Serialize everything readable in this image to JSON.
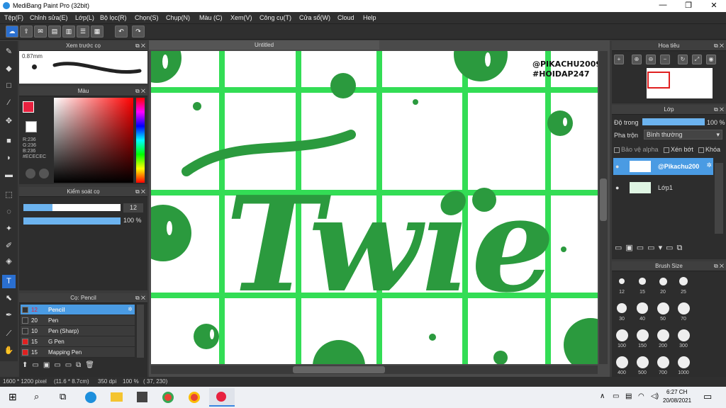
{
  "app": {
    "title": "MediBang Paint Pro (32bit)"
  },
  "menu": [
    "Tệp(F)",
    "Chỉnh sửa(E)",
    "Lớp(L)",
    "Bộ lọc(R)",
    "Chọn(S)",
    "Chụp(N)",
    "Màu (C)",
    "Xem(V)",
    "Công cụ(T)",
    "Cửa sổ(W)",
    "Cloud",
    "Help"
  ],
  "preview_panel": {
    "title": "Xem trước cọ",
    "size": "0.87mm"
  },
  "color_panel": {
    "title": "Màu",
    "r": "R:236",
    "g": "G:236",
    "b": "B:236",
    "hex": "#ECECEC",
    "colors": {
      "fg": "#e8213f",
      "hue": "#ff0000"
    }
  },
  "brush_control": {
    "title": "Kiểm soát cọ",
    "size": "12",
    "opacity": "100 %",
    "size_level": 0.3,
    "opacity_level": 1.0
  },
  "brush_panel": {
    "title": "Cọ: Pencil",
    "items": [
      {
        "size": "12",
        "name": "Pencil",
        "color": "#333333"
      },
      {
        "size": "20",
        "name": "Pen",
        "color": "#333333"
      },
      {
        "size": "10",
        "name": "Pen (Sharp)",
        "color": "#333333"
      },
      {
        "size": "15",
        "name": "G Pen",
        "color": "#e02020"
      },
      {
        "size": "15",
        "name": "Mapping Pen",
        "color": "#e02020"
      }
    ]
  },
  "document": {
    "tab": "Untitled",
    "watermark_line1": "@PIKACHU2009",
    "watermark_line2": "#HOIDAP247",
    "art_text": "Twie"
  },
  "navigator": {
    "title": "Hoa tiêu"
  },
  "layer_panel": {
    "title": "Lớp",
    "opacity_label": "Độ trong",
    "opacity_value": "100 %",
    "blend_label": "Pha trộn",
    "blend_value": "Bình thường",
    "protect_alpha": "Bảo vệ alpha",
    "clipping": "Xén bớt",
    "lock": "Khóa",
    "layers": [
      {
        "name": "@Pikachu200"
      },
      {
        "name": "Lớp1"
      }
    ]
  },
  "brush_size_panel": {
    "title": "Brush Size",
    "sizes": [
      "12",
      "15",
      "20",
      "25",
      "30",
      "40",
      "50",
      "70",
      "100",
      "150",
      "200",
      "300",
      "400",
      "500",
      "700",
      "1000"
    ]
  },
  "status": {
    "dimensions": "1600 * 1200 pixel",
    "physical": "(11.6 * 8.7cm)",
    "dpi": "350 dpi",
    "zoom": "100 %",
    "coords": "( 37, 230)"
  },
  "taskbar": {
    "time": "6:27 CH",
    "date": "20/08/2021"
  }
}
